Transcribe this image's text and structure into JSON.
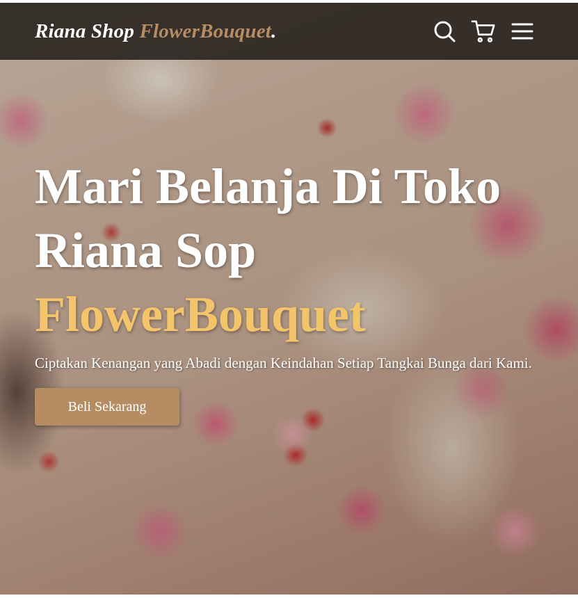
{
  "navbar": {
    "brand_main": "Riana Shop ",
    "brand_accent": "FlowerBouquet",
    "brand_dot": ".",
    "icons": [
      "search-icon",
      "shopping-cart-icon",
      "hamburger-menu-icon"
    ]
  },
  "hero": {
    "title_line1": "Mari Belanja Di Toko",
    "title_line2": "Riana Sop",
    "title_accent": "FlowerBouquet",
    "subtitle": "Ciptakan Kenangan yang Abadi dengan Keindahan Setiap Tangkai Bunga dari Kami.",
    "cta_label": "Beli Sekarang"
  },
  "colors": {
    "accent": "#b68d63",
    "title_accent": "#f3c46a",
    "navbar_bg": "#1a1614"
  }
}
